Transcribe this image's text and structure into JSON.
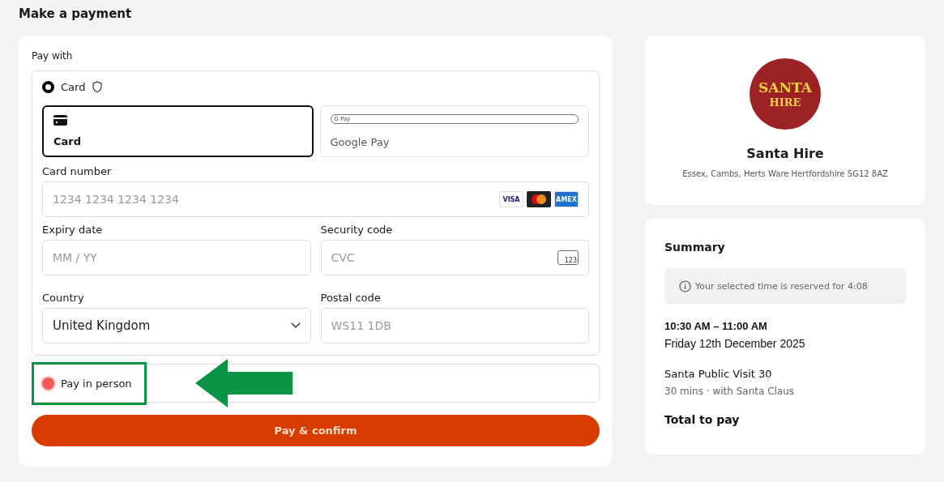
{
  "page_title": "Make a payment",
  "payment": {
    "heading": "Pay with",
    "methods": [
      {
        "kind": "card",
        "label": "Card",
        "selected": true
      },
      {
        "kind": "simple",
        "label": "Pay in person",
        "selected": false,
        "highlighted": true
      }
    ],
    "wallet_tabs": [
      {
        "kind": "card",
        "label": "Card",
        "selected": true
      },
      {
        "kind": "gpay",
        "label": "Google Pay",
        "badge": "G Pay",
        "selected": false
      }
    ],
    "card_number": {
      "label": "Card number",
      "placeholder": "1234 1234 1234 1234",
      "brands": [
        "VISA",
        "AMEX"
      ]
    },
    "expiry": {
      "label": "Expiry date",
      "placeholder": "MM / YY"
    },
    "security": {
      "label": "Security code",
      "placeholder": "CVC",
      "icon_text": "123"
    },
    "country": {
      "label": "Country",
      "value": "United Kingdom"
    },
    "postal": {
      "label": "Postal code",
      "placeholder": "WS11 1DB"
    },
    "submit": "Pay & confirm"
  },
  "merchant": {
    "logo_lines": [
      "SANTA",
      "HIRE"
    ],
    "name": "Santa Hire",
    "address": "Essex, Cambs, Herts Ware Hertfordshire SG12 8AZ"
  },
  "summary": {
    "title": "Summary",
    "notice": "Your selected time is reserved for 4:08",
    "time": "10:30 AM – 11:00 AM",
    "date": "Friday 12th December 2025",
    "item": "Santa Public Visit 30",
    "item_detail": "30 mins · with Santa Claus",
    "total_label": "Total to pay"
  }
}
